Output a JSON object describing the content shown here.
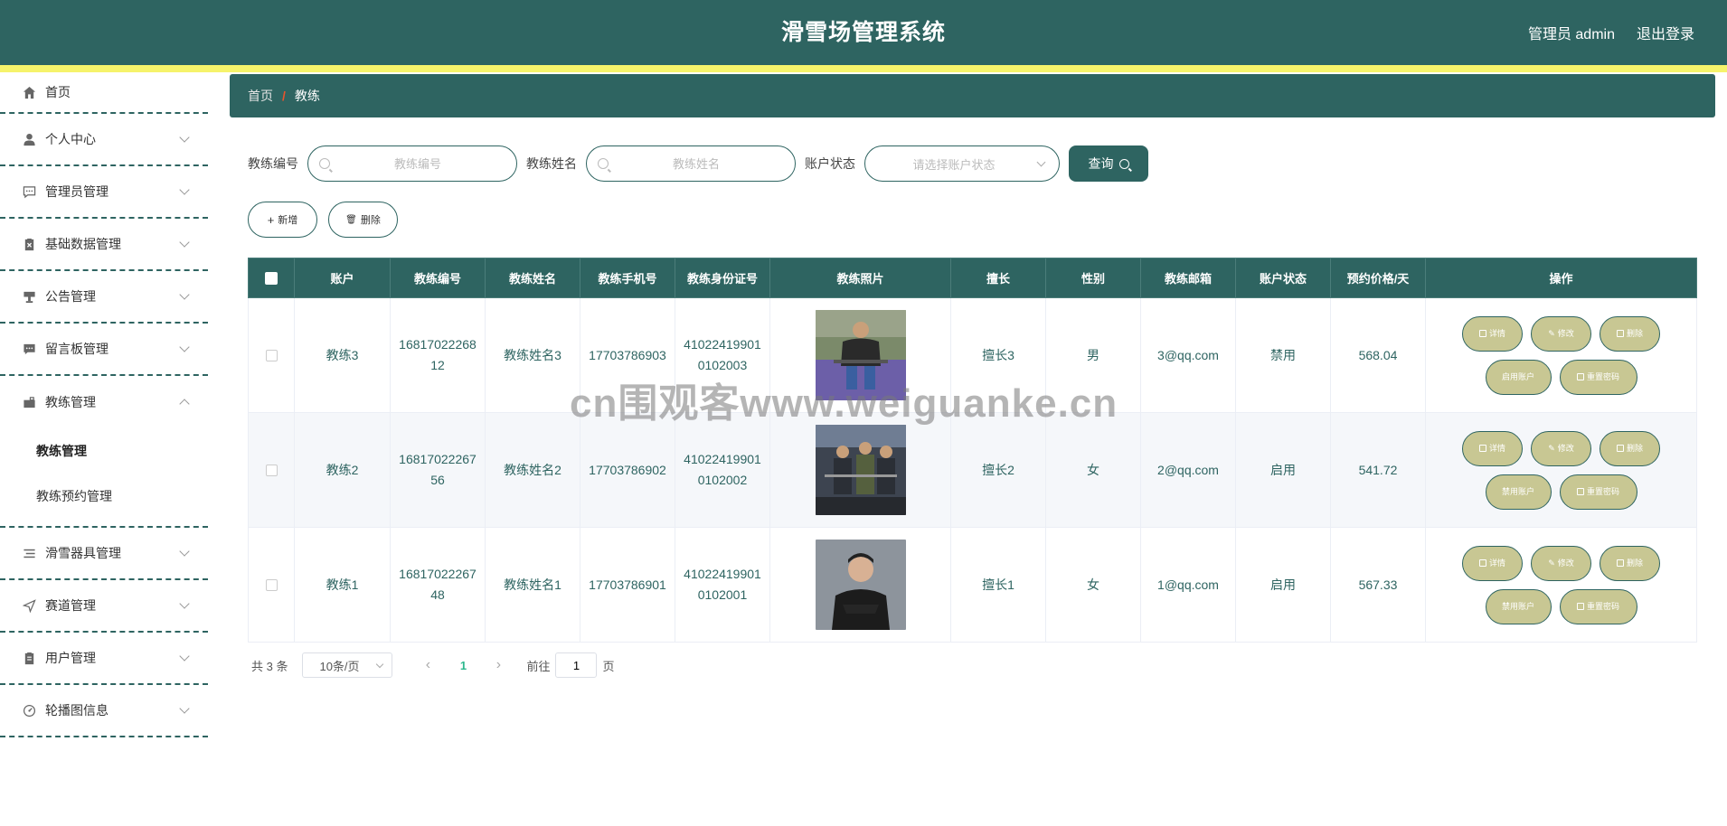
{
  "header": {
    "title": "滑雪场管理系统",
    "user": "管理员 admin",
    "logout": "退出登录"
  },
  "sidebar": {
    "items": [
      {
        "label": "首页",
        "icon": "home-icon"
      },
      {
        "label": "个人中心",
        "icon": "user-icon"
      },
      {
        "label": "管理员管理",
        "icon": "chat-icon"
      },
      {
        "label": "基础数据管理",
        "icon": "clipboard-x-icon"
      },
      {
        "label": "公告管理",
        "icon": "podium-icon"
      },
      {
        "label": "留言板管理",
        "icon": "message-icon"
      },
      {
        "label": "教练管理",
        "icon": "briefcase-icon"
      },
      {
        "label": "滑雪器具管理",
        "icon": "list-icon"
      },
      {
        "label": "赛道管理",
        "icon": "send-icon"
      },
      {
        "label": "用户管理",
        "icon": "clipboard-icon"
      },
      {
        "label": "轮播图信息",
        "icon": "gauge-icon"
      }
    ],
    "submenu": [
      "教练管理",
      "教练预约管理"
    ]
  },
  "breadcrumb": {
    "home": "首页",
    "separator": "/",
    "current": "教练"
  },
  "search": {
    "code_label": "教练编号",
    "code_placeholder": "教练编号",
    "name_label": "教练姓名",
    "name_placeholder": "教练姓名",
    "status_label": "账户状态",
    "status_placeholder": "请选择账户状态",
    "query": "查询"
  },
  "actions": {
    "add": "新增",
    "delete": "删除"
  },
  "table": {
    "headers": [
      "账户",
      "教练编号",
      "教练姓名",
      "教练手机号",
      "教练身份证号",
      "教练照片",
      "擅长",
      "性别",
      "教练邮箱",
      "账户状态",
      "预约价格/天",
      "操作"
    ],
    "rows": [
      {
        "account": "教练3",
        "code": "1681702226812",
        "name": "教练姓名3",
        "phone": "17703786903",
        "idcard": "410224199010102003",
        "skill": "擅长3",
        "gender": "男",
        "email": "3@qq.com",
        "status": "禁用",
        "price": "568.04",
        "toggle": "启用账户"
      },
      {
        "account": "教练2",
        "code": "1681702226756",
        "name": "教练姓名2",
        "phone": "17703786902",
        "idcard": "410224199010102002",
        "skill": "擅长2",
        "gender": "女",
        "email": "2@qq.com",
        "status": "启用",
        "price": "541.72",
        "toggle": "禁用账户"
      },
      {
        "account": "教练1",
        "code": "1681702226748",
        "name": "教练姓名1",
        "phone": "17703786901",
        "idcard": "410224199010102001",
        "skill": "擅长1",
        "gender": "女",
        "email": "1@qq.com",
        "status": "启用",
        "price": "567.33",
        "toggle": "禁用账户"
      }
    ],
    "op_detail": "详情",
    "op_edit": "修改",
    "op_delete": "删除",
    "op_reset": "重置密码"
  },
  "pager": {
    "total": "共 3 条",
    "size": "10条/页",
    "prev": "‹",
    "current": "1",
    "next": "›",
    "goto": "前往",
    "goto_value": "1",
    "page_unit": "页"
  },
  "watermark": "cn围观客www.weiguanke.cn",
  "colors": {
    "primary": "#2e6461",
    "stripe": "#f6f36b",
    "op_button": "#c8c793",
    "accent_separator": "#e9542c",
    "page_active": "#2eb88e"
  }
}
